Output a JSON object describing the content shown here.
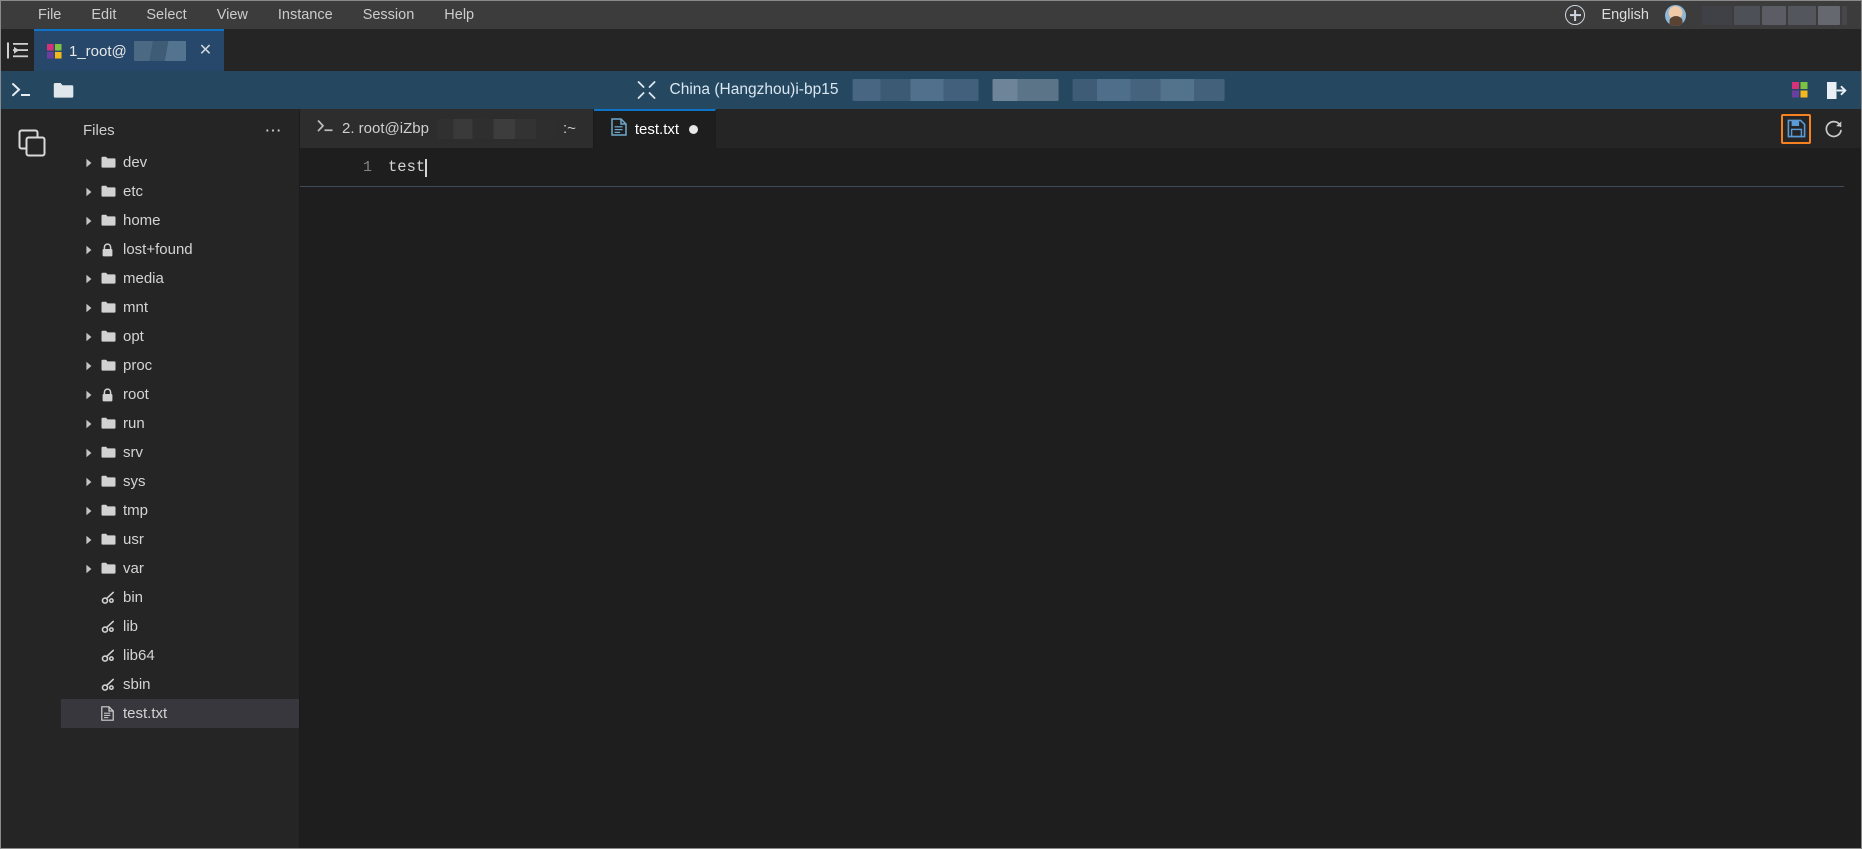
{
  "menubar": {
    "items": [
      {
        "label": "File",
        "name": "menu-file"
      },
      {
        "label": "Edit",
        "name": "menu-edit"
      },
      {
        "label": "Select",
        "name": "menu-select"
      },
      {
        "label": "View",
        "name": "menu-view"
      },
      {
        "label": "Instance",
        "name": "menu-instance"
      },
      {
        "label": "Session",
        "name": "menu-session"
      },
      {
        "label": "Help",
        "name": "menu-help"
      }
    ],
    "add_icon": "plus-circle-icon",
    "language": "English",
    "avatar": "user-avatar",
    "user_name_redacted": ""
  },
  "session_tabs": {
    "sidebar_toggle_icon": "collapse-panel-icon",
    "tabs": [
      {
        "label": "1_root@",
        "icon": "puzzle-icon",
        "close_icon": "close-icon",
        "active": true
      }
    ]
  },
  "instance_bar": {
    "terminal_icon": "terminal-prompt-icon",
    "folder_icon": "folder-icon",
    "fullscreen_icon": "fullscreen-expand-icon",
    "instance_title": "China (Hangzhou)i-bp15",
    "extension_icon": "puzzle-icon",
    "exit_icon": "exit-session-icon"
  },
  "activity_bar": {
    "items": [
      {
        "name": "activity-files",
        "icon": "files-copy-icon",
        "active": true
      }
    ]
  },
  "sidebar": {
    "title": "Files",
    "more_icon": "more-options-icon",
    "items": [
      {
        "label": "dev",
        "icon": "folder-icon",
        "expandable": true,
        "selected": false
      },
      {
        "label": "etc",
        "icon": "folder-icon",
        "expandable": true,
        "selected": false
      },
      {
        "label": "home",
        "icon": "folder-icon",
        "expandable": true,
        "selected": false
      },
      {
        "label": "lost+found",
        "icon": "lock-icon",
        "expandable": true,
        "selected": false
      },
      {
        "label": "media",
        "icon": "folder-icon",
        "expandable": true,
        "selected": false
      },
      {
        "label": "mnt",
        "icon": "folder-icon",
        "expandable": true,
        "selected": false
      },
      {
        "label": "opt",
        "icon": "folder-icon",
        "expandable": true,
        "selected": false
      },
      {
        "label": "proc",
        "icon": "folder-icon",
        "expandable": true,
        "selected": false
      },
      {
        "label": "root",
        "icon": "lock-icon",
        "expandable": true,
        "selected": false
      },
      {
        "label": "run",
        "icon": "folder-icon",
        "expandable": true,
        "selected": false
      },
      {
        "label": "srv",
        "icon": "folder-icon",
        "expandable": true,
        "selected": false
      },
      {
        "label": "sys",
        "icon": "folder-icon",
        "expandable": true,
        "selected": false
      },
      {
        "label": "tmp",
        "icon": "folder-icon",
        "expandable": true,
        "selected": false
      },
      {
        "label": "usr",
        "icon": "folder-icon",
        "expandable": true,
        "selected": false
      },
      {
        "label": "var",
        "icon": "folder-icon",
        "expandable": true,
        "selected": false
      },
      {
        "label": "bin",
        "icon": "symlink-icon",
        "expandable": false,
        "selected": false
      },
      {
        "label": "lib",
        "icon": "symlink-icon",
        "expandable": false,
        "selected": false
      },
      {
        "label": "lib64",
        "icon": "symlink-icon",
        "expandable": false,
        "selected": false
      },
      {
        "label": "sbin",
        "icon": "symlink-icon",
        "expandable": false,
        "selected": false
      },
      {
        "label": "test.txt",
        "icon": "file-icon",
        "expandable": false,
        "selected": true
      }
    ]
  },
  "editor": {
    "tabs": [
      {
        "label": "2. root@iZbp",
        "suffix": ":~",
        "icon": "terminal-prompt-icon",
        "active": false,
        "dirty": false
      },
      {
        "label": "test.txt",
        "suffix": "",
        "icon": "file-document-icon",
        "active": true,
        "dirty": true
      }
    ],
    "actions": {
      "save_icon": "save-disk-icon",
      "refresh_icon": "refresh-icon"
    },
    "gutter": {
      "line_numbers": [
        "1"
      ]
    },
    "content": {
      "lines": [
        "test"
      ],
      "cursor_line": 1,
      "cursor_column": 5
    }
  },
  "colors": {
    "menubar_bg": "#3c3c3c",
    "tabstrip_bg": "#252526",
    "session_tab_bg": "#27486a",
    "accent_blue": "#0e74c8",
    "instance_bar_bg": "#254860",
    "editor_bg": "#1e1e1e",
    "sidebar_bg": "#252526",
    "selected_row_bg": "#37373d",
    "text_primary": "#d4d4d4",
    "highlight_orange": "#f5821f"
  }
}
